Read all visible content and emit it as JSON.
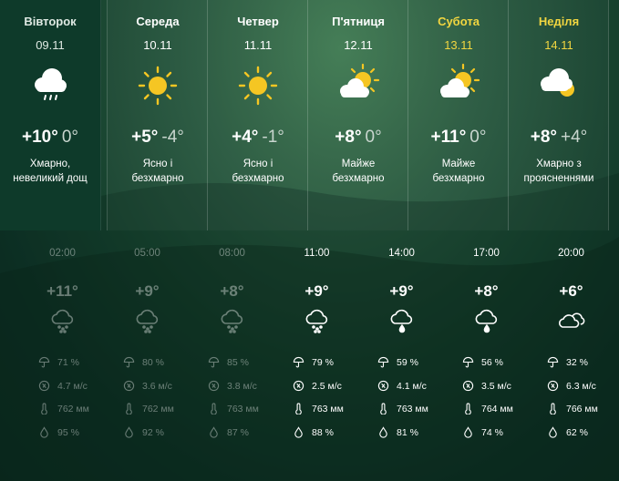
{
  "days": [
    {
      "name": "Вівторок",
      "date": "09.11",
      "temp_hi": "+10°",
      "temp_lo": "0°",
      "desc1": "Хмарно,",
      "desc2": "невеликий дощ",
      "icon": "rain-cloud-icon",
      "active": true,
      "weekend": false
    },
    {
      "name": "Середа",
      "date": "10.11",
      "temp_hi": "+5°",
      "temp_lo": "-4°",
      "desc1": "Ясно і",
      "desc2": "безхмарно",
      "icon": "sun-icon",
      "active": false,
      "weekend": false
    },
    {
      "name": "Четвер",
      "date": "11.11",
      "temp_hi": "+4°",
      "temp_lo": "-1°",
      "desc1": "Ясно і",
      "desc2": "безхмарно",
      "icon": "sun-icon",
      "active": false,
      "weekend": false
    },
    {
      "name": "П'ятниця",
      "date": "12.11",
      "temp_hi": "+8°",
      "temp_lo": "0°",
      "desc1": "Майже",
      "desc2": "безхмарно",
      "icon": "sun-cloud-icon",
      "active": false,
      "weekend": false
    },
    {
      "name": "Субота",
      "date": "13.11",
      "temp_hi": "+11°",
      "temp_lo": "0°",
      "desc1": "Майже",
      "desc2": "безхмарно",
      "icon": "sun-cloud-icon",
      "active": false,
      "weekend": true
    },
    {
      "name": "Неділя",
      "date": "14.11",
      "temp_hi": "+8°",
      "temp_lo": "+4°",
      "desc1": "Хмарно з",
      "desc2": "проясненнями",
      "icon": "cloud-sun-icon",
      "active": false,
      "weekend": true
    }
  ],
  "hours": [
    {
      "time": "02:00",
      "temp": "+11°",
      "icon": "snow-rain-cloud-icon",
      "precip": "71 %",
      "wind": "4.7 м/с",
      "pressure": "762 мм",
      "humidity": "95 %",
      "past": true
    },
    {
      "time": "05:00",
      "temp": "+9°",
      "icon": "snow-rain-cloud-icon",
      "precip": "80 %",
      "wind": "3.6 м/с",
      "pressure": "762 мм",
      "humidity": "92 %",
      "past": true
    },
    {
      "time": "08:00",
      "temp": "+8°",
      "icon": "snow-rain-cloud-icon",
      "precip": "85 %",
      "wind": "3.8 м/с",
      "pressure": "763 мм",
      "humidity": "87 %",
      "past": true
    },
    {
      "time": "11:00",
      "temp": "+9°",
      "icon": "snow-rain-cloud-icon",
      "precip": "79 %",
      "wind": "2.5 м/с",
      "pressure": "763 мм",
      "humidity": "88 %",
      "past": false
    },
    {
      "time": "14:00",
      "temp": "+9°",
      "icon": "rain-drop-cloud-icon",
      "precip": "59 %",
      "wind": "4.1 м/с",
      "pressure": "763 мм",
      "humidity": "81 %",
      "past": false
    },
    {
      "time": "17:00",
      "temp": "+8°",
      "icon": "rain-drop-cloud-icon",
      "precip": "56 %",
      "wind": "3.5 м/с",
      "pressure": "764 мм",
      "humidity": "74 %",
      "past": false
    },
    {
      "time": "20:00",
      "temp": "+6°",
      "icon": "clouds-icon",
      "precip": "32 %",
      "wind": "6.3 м/с",
      "pressure": "766 мм",
      "humidity": "62 %",
      "past": false
    }
  ],
  "colors": {
    "background": "#0c2d22",
    "weekend": "#f2d640",
    "sun": "#f5c623",
    "active_day": "#0e3a2a"
  }
}
